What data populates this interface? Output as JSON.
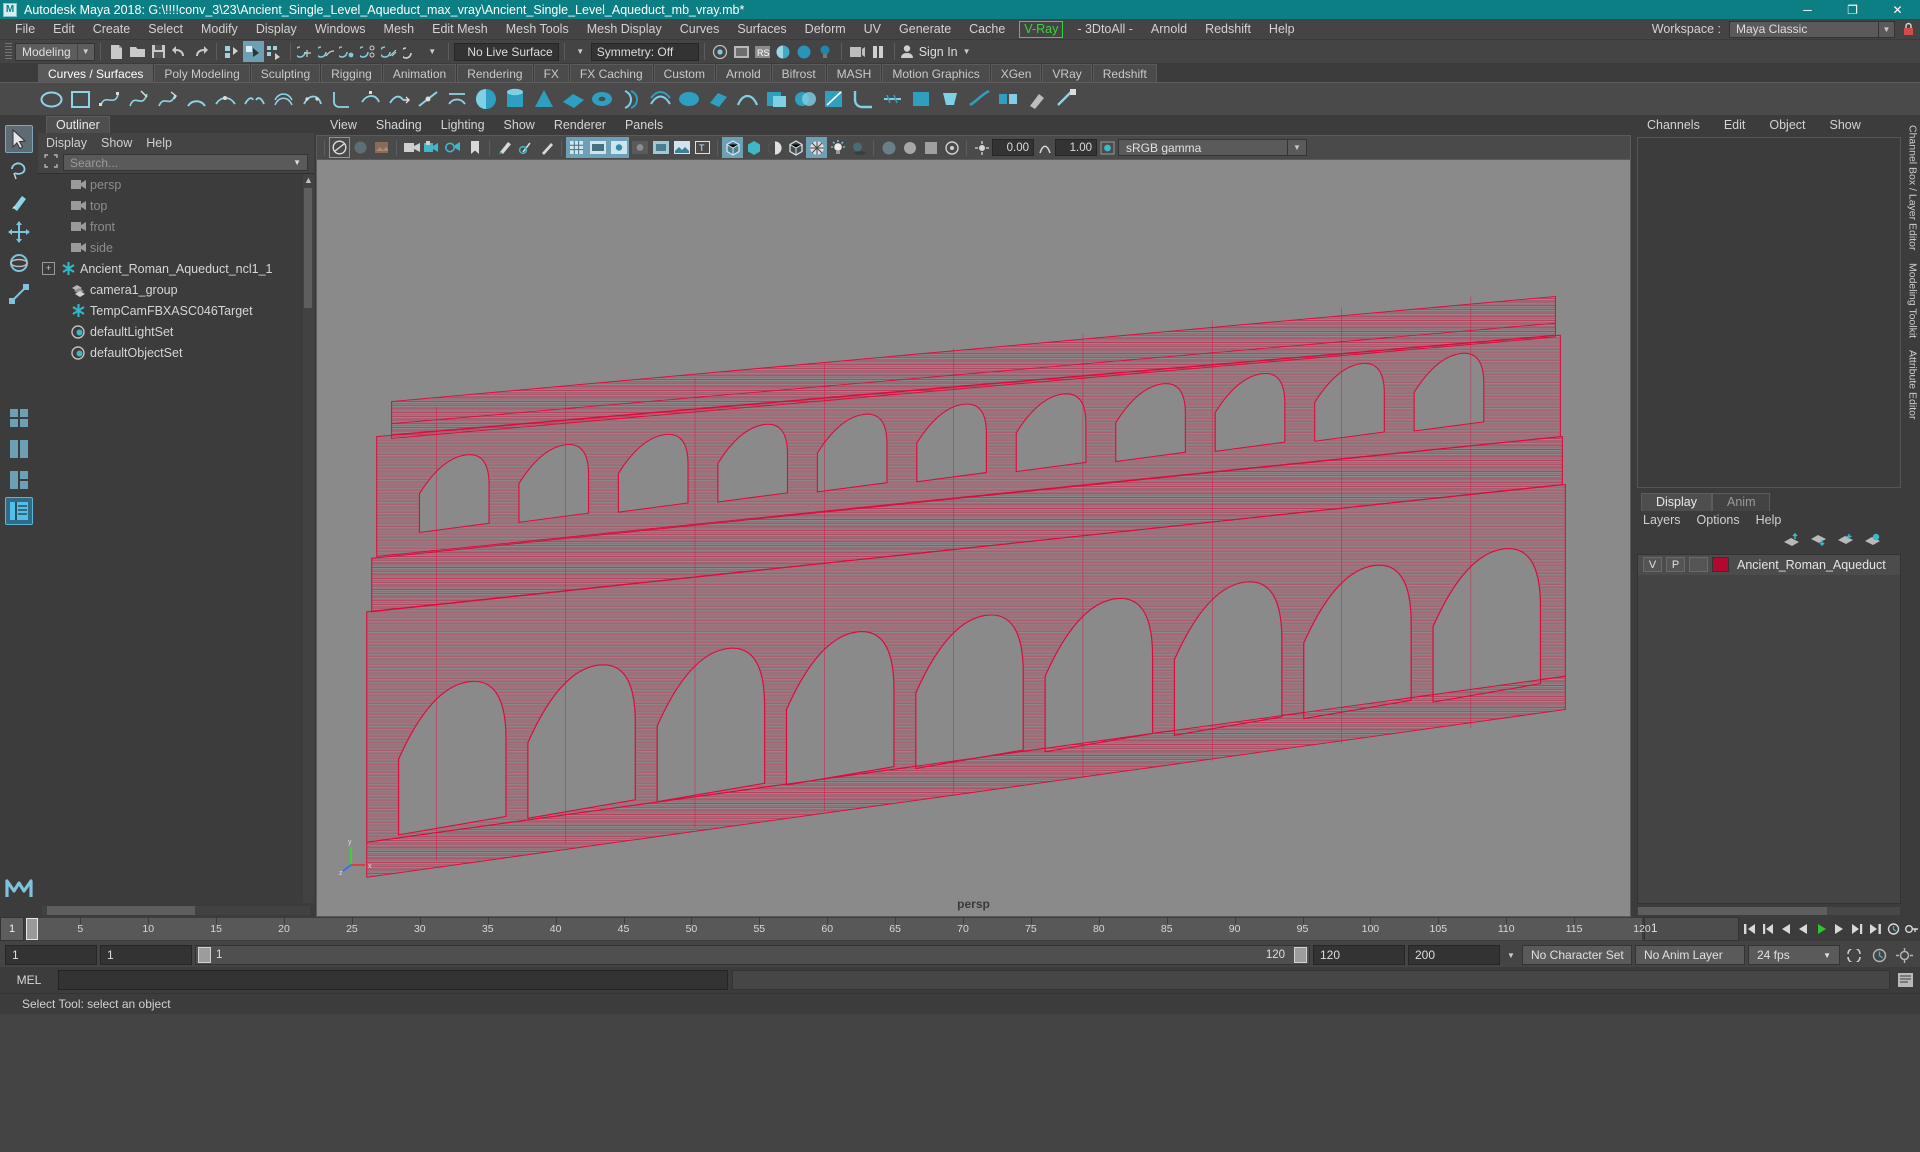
{
  "titlebar": {
    "app_title": "Autodesk Maya 2018: G:\\!!!!conv_3\\23\\Ancient_Single_Level_Aqueduct_max_vray\\Ancient_Single_Level_Aqueduct_mb_vray.mb*",
    "logo": "M",
    "minimize": "─",
    "maximize": "❐",
    "close": "✕"
  },
  "menubar": {
    "items": [
      {
        "label": "File"
      },
      {
        "label": "Edit"
      },
      {
        "label": "Create"
      },
      {
        "label": "Select"
      },
      {
        "label": "Modify"
      },
      {
        "label": "Display"
      },
      {
        "label": "Windows"
      },
      {
        "label": "Mesh"
      },
      {
        "label": "Edit Mesh"
      },
      {
        "label": "Mesh Tools"
      },
      {
        "label": "Mesh Display"
      },
      {
        "label": "Curves"
      },
      {
        "label": "Surfaces"
      },
      {
        "label": "Deform"
      },
      {
        "label": "UV"
      },
      {
        "label": "Generate"
      },
      {
        "label": "Cache"
      },
      {
        "label": "V-Ray"
      },
      {
        "label": "- 3DtoAll -"
      },
      {
        "label": "Arnold"
      },
      {
        "label": "Redshift"
      },
      {
        "label": "Help"
      }
    ],
    "workspace_label": "Workspace :",
    "workspace_value": "Maya Classic"
  },
  "statusline": {
    "menuset": "Modeling",
    "live_surface": "No Live Surface",
    "symmetry": "Symmetry: Off",
    "num1": "0.00",
    "num2": "1.00",
    "signin": "Sign In"
  },
  "shelf": {
    "tabs": [
      {
        "label": "Curves / Surfaces",
        "active": true
      },
      {
        "label": "Poly Modeling",
        "active": false
      },
      {
        "label": "Sculpting",
        "active": false
      },
      {
        "label": "Rigging",
        "active": false
      },
      {
        "label": "Animation",
        "active": false
      },
      {
        "label": "Rendering",
        "active": false
      },
      {
        "label": "FX",
        "active": false
      },
      {
        "label": "FX Caching",
        "active": false
      },
      {
        "label": "Custom",
        "active": false
      },
      {
        "label": "Arnold",
        "active": false
      },
      {
        "label": "Bifrost",
        "active": false
      },
      {
        "label": "MASH",
        "active": false
      },
      {
        "label": "Motion Graphics",
        "active": false
      },
      {
        "label": "XGen",
        "active": false
      },
      {
        "label": "VRay",
        "active": false
      },
      {
        "label": "Redshift",
        "active": false
      }
    ]
  },
  "outliner": {
    "tab_label": "Outliner",
    "menus": [
      "Display",
      "Show",
      "Help"
    ],
    "search_placeholder": "Search...",
    "items": [
      {
        "label": "persp",
        "icon": "camera-icon",
        "dim": true,
        "expandable": false
      },
      {
        "label": "top",
        "icon": "camera-icon",
        "dim": true,
        "expandable": false
      },
      {
        "label": "front",
        "icon": "camera-icon",
        "dim": true,
        "expandable": false
      },
      {
        "label": "side",
        "icon": "camera-icon",
        "dim": true,
        "expandable": false
      },
      {
        "label": "Ancient_Roman_Aqueduct_ncl1_1",
        "icon": "transform-icon",
        "dim": false,
        "expandable": true
      },
      {
        "label": "camera1_group",
        "icon": "group-icon",
        "dim": false,
        "expandable": false
      },
      {
        "label": "TempCamFBXASC046Target",
        "icon": "transform-icon",
        "dim": false,
        "expandable": false
      },
      {
        "label": "defaultLightSet",
        "icon": "set-icon",
        "dim": false,
        "expandable": false
      },
      {
        "label": "defaultObjectSet",
        "icon": "set-icon",
        "dim": false,
        "expandable": false
      }
    ]
  },
  "viewport": {
    "menus": [
      "View",
      "Shading",
      "Lighting",
      "Show",
      "Renderer",
      "Panels"
    ],
    "exposure": "0.00",
    "gamma_num": "1.00",
    "color_profile": "sRGB gamma",
    "camera_label": "persp",
    "axis": {
      "x": "x",
      "y": "y",
      "z": "z"
    },
    "model_color": "#de0a3c",
    "background_color": "#8a8a8a"
  },
  "channelbox": {
    "tabs": [
      "Channels",
      "Edit",
      "Object",
      "Show"
    ]
  },
  "layers": {
    "tabs": [
      {
        "label": "Display",
        "active": true
      },
      {
        "label": "Anim",
        "active": false
      }
    ],
    "menus": [
      "Layers",
      "Options",
      "Help"
    ],
    "rows": [
      {
        "visible": "V",
        "playback": "P",
        "shade": "",
        "color": "#b4082f",
        "name": "Ancient_Roman_Aqueduct"
      }
    ]
  },
  "vertical_tabs": [
    "Channel Box / Layer Editor",
    "Modeling Toolkit",
    "Attribute Editor"
  ],
  "timeline": {
    "current_frame": "1",
    "ticks": [
      {
        "label": "5",
        "value": 5
      },
      {
        "label": "10",
        "value": 10
      },
      {
        "label": "15",
        "value": 15
      },
      {
        "label": "20",
        "value": 20
      },
      {
        "label": "25",
        "value": 25
      },
      {
        "label": "30",
        "value": 30
      },
      {
        "label": "35",
        "value": 35
      },
      {
        "label": "40",
        "value": 40
      },
      {
        "label": "45",
        "value": 45
      },
      {
        "label": "50",
        "value": 50
      },
      {
        "label": "55",
        "value": 55
      },
      {
        "label": "60",
        "value": 60
      },
      {
        "label": "65",
        "value": 65
      },
      {
        "label": "70",
        "value": 70
      },
      {
        "label": "75",
        "value": 75
      },
      {
        "label": "80",
        "value": 80
      },
      {
        "label": "85",
        "value": 85
      },
      {
        "label": "90",
        "value": 90
      },
      {
        "label": "95",
        "value": 95
      },
      {
        "label": "100",
        "value": 100
      },
      {
        "label": "105",
        "value": 105
      },
      {
        "label": "110",
        "value": 110
      },
      {
        "label": "115",
        "value": 115
      },
      {
        "label": "120",
        "value": 120
      }
    ],
    "range_field": "1",
    "frame_min": 1,
    "frame_max": 120
  },
  "rangerow": {
    "start_field": "1",
    "start_field2": "1",
    "range_start": "1",
    "range_end": "120",
    "end_field": "120",
    "end_field2": "200",
    "character_set": "No Character Set",
    "anim_layer": "No Anim Layer",
    "fps": "24 fps"
  },
  "commandline": {
    "label": "MEL",
    "input_value": "",
    "output_value": ""
  },
  "helpline": {
    "text": "Select Tool: select an object"
  }
}
